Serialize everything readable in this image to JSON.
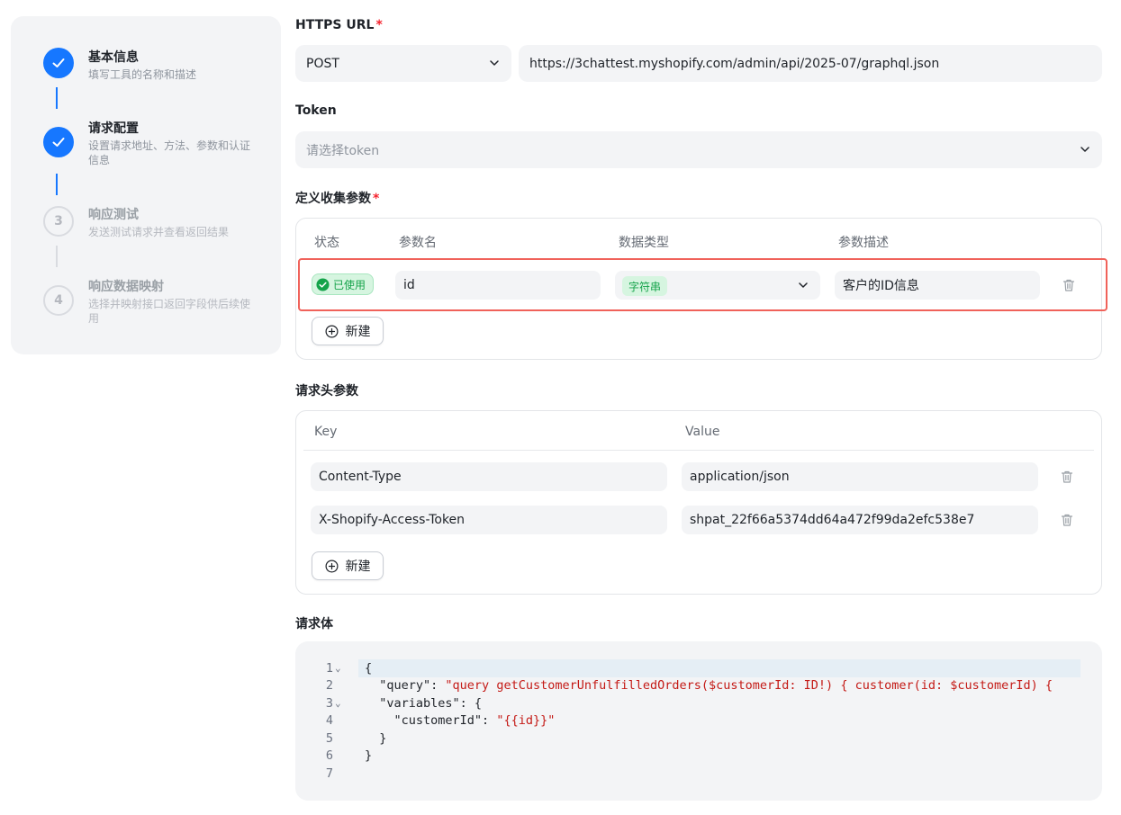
{
  "steps": [
    {
      "number": "1",
      "title": "基本信息",
      "desc": "填写工具的名称和描述",
      "state": "done"
    },
    {
      "number": "2",
      "title": "请求配置",
      "desc": "设置请求地址、方法、参数和认证信息",
      "state": "done"
    },
    {
      "number": "3",
      "title": "响应测试",
      "desc": "发送测试请求并查看返回结果",
      "state": "todo"
    },
    {
      "number": "4",
      "title": "响应数据映射",
      "desc": "选择并映射接口返回字段供后续使用",
      "state": "todo"
    }
  ],
  "url_section": {
    "label": "HTTPS URL",
    "required_mark": "*",
    "method": "POST",
    "url": "https://3chattest.myshopify.com/admin/api/2025-07/graphql.json"
  },
  "token_section": {
    "label": "Token",
    "placeholder": "请选择token"
  },
  "params_section": {
    "label": "定义收集参数",
    "required_mark": "*",
    "headers": [
      "状态",
      "参数名",
      "数据类型",
      "参数描述"
    ],
    "rows": [
      {
        "status": "已使用",
        "name": "id",
        "type": "字符串",
        "description": "客户的ID信息"
      }
    ],
    "new_label": "新建"
  },
  "headers_section": {
    "label": "请求头参数",
    "headers": [
      "Key",
      "Value"
    ],
    "rows": [
      {
        "key": "Content-Type",
        "value": "application/json"
      },
      {
        "key": "X-Shopify-Access-Token",
        "value": "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"
      }
    ],
    "new_label": "新建"
  },
  "body_section": {
    "label": "请求体",
    "lines": [
      {
        "num": "1",
        "fold": "⌄",
        "parts": [
          [
            "k",
            "{"
          ]
        ]
      },
      {
        "num": "2",
        "fold": "",
        "parts": [
          [
            "k",
            "  \""
          ],
          [
            "k",
            "query"
          ],
          [
            "k",
            "\": "
          ],
          [
            "s",
            "\"query getCustomerUnfulfilledOrders($customerId: ID!) { customer(id: $customerId) {"
          ]
        ]
      },
      {
        "num": "3",
        "fold": "⌄",
        "parts": [
          [
            "k",
            "  \"variables\": {"
          ]
        ]
      },
      {
        "num": "4",
        "fold": "",
        "parts": [
          [
            "k",
            "    \"customerId\": "
          ],
          [
            "s",
            "\"{{id}}\""
          ]
        ]
      },
      {
        "num": "5",
        "fold": "",
        "parts": [
          [
            "k",
            "  }"
          ]
        ]
      },
      {
        "num": "6",
        "fold": "",
        "parts": [
          [
            "k",
            "}"
          ]
        ]
      },
      {
        "num": "7",
        "fold": "",
        "parts": [
          [
            "k",
            ""
          ]
        ]
      }
    ]
  },
  "colors": {
    "primary": "#1677ff",
    "success": "#15a34a",
    "highlight": "#f0625a",
    "string": "#c41a16"
  }
}
